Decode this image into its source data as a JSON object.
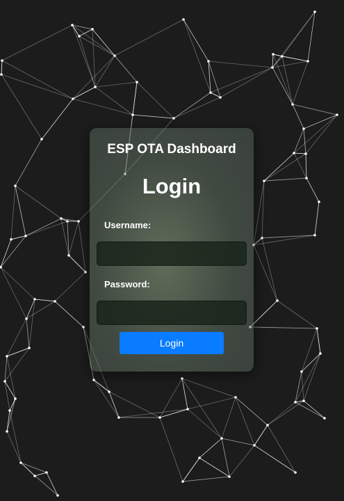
{
  "page": {
    "background_color": "#1c1c1c",
    "background_graphic": "network-lines"
  },
  "login_card": {
    "app_title": "ESP OTA Dashboard",
    "heading": "Login",
    "username_label": "Username:",
    "username_value": "",
    "password_label": "Password:",
    "password_value": "",
    "submit_label": "Login",
    "button_color": "#0a7cff"
  }
}
